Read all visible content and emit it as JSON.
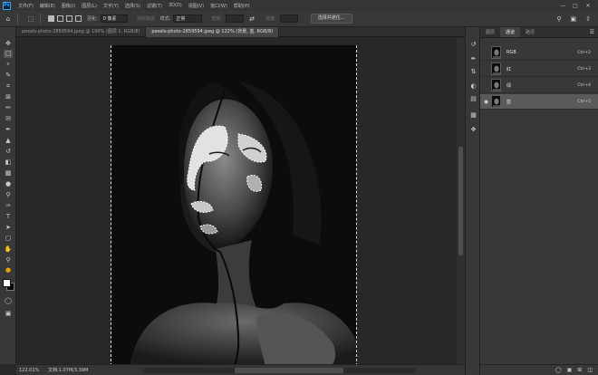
{
  "app": {
    "logo": "Ps"
  },
  "menubar": {
    "items": [
      "文件(F)",
      "编辑(E)",
      "图像(I)",
      "图层(L)",
      "文字(Y)",
      "选择(S)",
      "滤镜(T)",
      "3D(D)",
      "视图(V)",
      "窗口(W)",
      "帮助(H)"
    ],
    "window_buttons": [
      "minimize",
      "maximize",
      "close"
    ]
  },
  "optionsbar": {
    "feather_label": "羽化:",
    "feather_value": "0 像素",
    "antialias_label": "消除锯齿",
    "style_label": "样式:",
    "style_value": "正常",
    "width_label": "宽度:",
    "height_label": "高度:",
    "select_mask_button": "选择并遮住..."
  },
  "tabs": [
    {
      "label": "pexels-photo-2859594.jpeg @ 100% (图层 1, RGB/8)",
      "active": false
    },
    {
      "label": "pexels-photo-2859594.jpeg @ 122% (背景, 蓝, RGB/8)",
      "active": true
    }
  ],
  "status": {
    "zoom": "122.01%",
    "doc_info": "文档:1.07M/3.39M"
  },
  "panel": {
    "tabs": [
      {
        "label": "图层",
        "active": false
      },
      {
        "label": "通道",
        "active": true
      },
      {
        "label": "路径",
        "active": false
      }
    ],
    "channels": [
      {
        "name": "RGB",
        "shortcut": "Ctrl+2",
        "visible": false,
        "selected": false
      },
      {
        "name": "红",
        "shortcut": "Ctrl+3",
        "visible": false,
        "selected": false
      },
      {
        "name": "绿",
        "shortcut": "Ctrl+4",
        "visible": false,
        "selected": false
      },
      {
        "name": "蓝",
        "shortcut": "Ctrl+5",
        "visible": true,
        "selected": true
      }
    ]
  },
  "colors": {
    "foreground": "#ffffff",
    "background": "#000000",
    "accent": "#31a8ff",
    "ui_background": "#282828"
  }
}
